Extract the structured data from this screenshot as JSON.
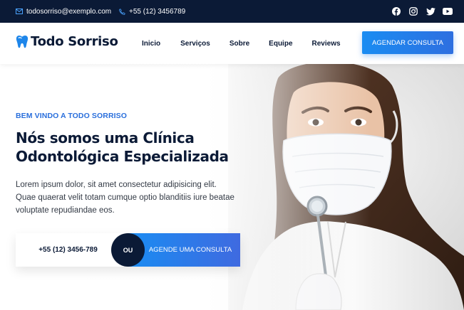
{
  "topbar": {
    "email": "todosorriso@exemplo.com",
    "phone": "+55 (12) 3456789",
    "socials": [
      "facebook-icon",
      "instagram-icon",
      "twitter-icon",
      "youtube-icon"
    ]
  },
  "header": {
    "logo_text": "Todo Sorriso",
    "nav": [
      "Inicio",
      "Serviços",
      "Sobre",
      "Equipe",
      "Reviews"
    ],
    "cta": "AGENDAR CONSULTA"
  },
  "hero": {
    "eyebrow": "BEM VINDO A TODO SORRISO",
    "title": "Nós somos uma Clínica Odontológica Especializada",
    "description": "Lorem ipsum dolor, sit amet consectetur adipisicing elit. Quae quaerat velit totam cumque optio blanditiis iure beatae voluptate repudiandae eos.",
    "phone_button": "+55 (12) 3456-789",
    "or_label": "OU",
    "schedule_button": "AGENDE UMA CONSULTA"
  },
  "colors": {
    "navy": "#0b1a36",
    "accent_blue": "#2a6fdc",
    "button_gradient_start": "#1a8cf2",
    "button_gradient_end": "#3f6ae0"
  }
}
